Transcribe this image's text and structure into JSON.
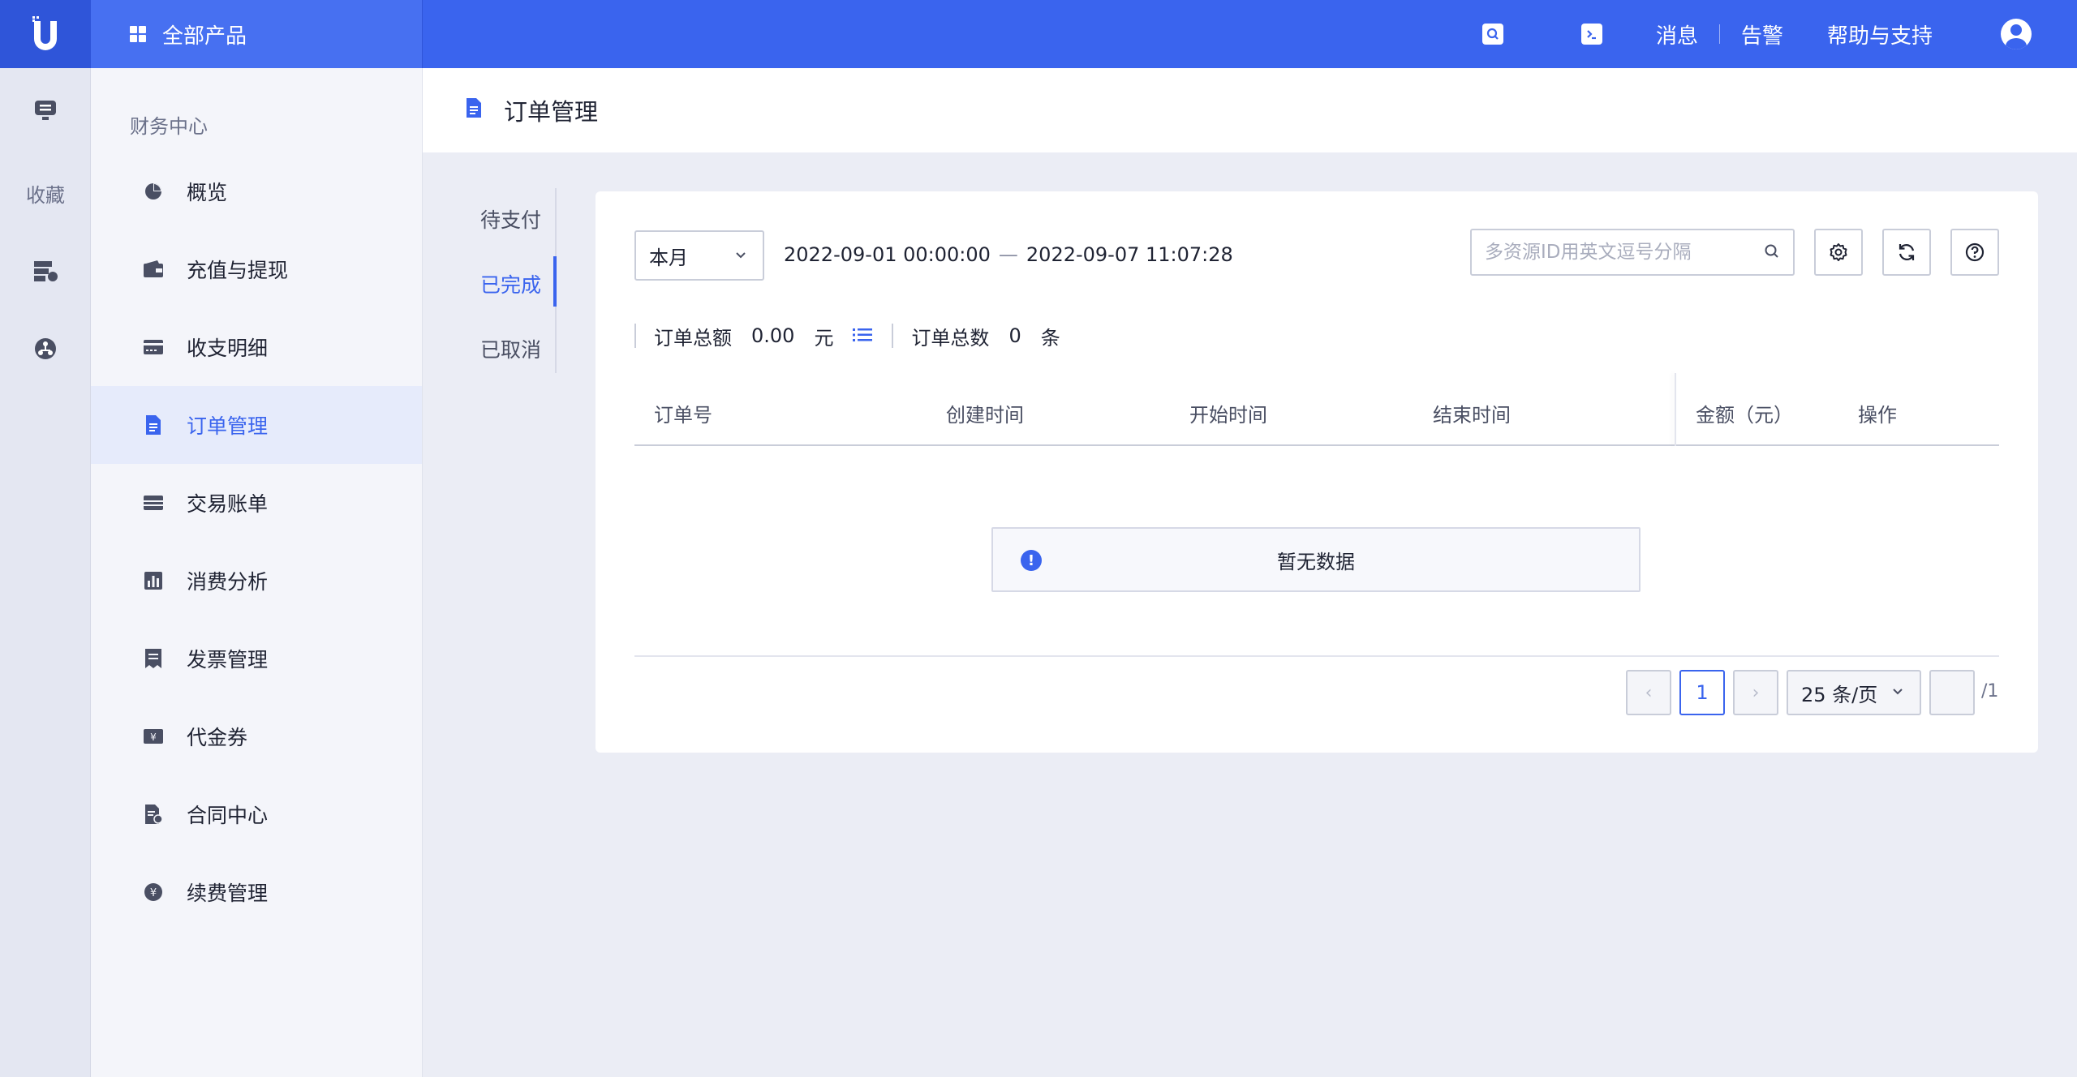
{
  "topbar": {
    "all_products": "全部产品",
    "links": [
      "消息",
      "告警",
      "帮助与支持"
    ]
  },
  "rail": {
    "favorites": "收藏"
  },
  "sidebar": {
    "title": "财务中心",
    "items": [
      {
        "label": "概览",
        "icon": "pie-chart-icon"
      },
      {
        "label": "充值与提现",
        "icon": "wallet-icon"
      },
      {
        "label": "收支明细",
        "icon": "card-icon"
      },
      {
        "label": "订单管理",
        "icon": "document-icon",
        "active": true
      },
      {
        "label": "交易账单",
        "icon": "ledger-icon"
      },
      {
        "label": "消费分析",
        "icon": "bar-chart-icon"
      },
      {
        "label": "发票管理",
        "icon": "invoice-icon"
      },
      {
        "label": "代金券",
        "icon": "voucher-icon"
      },
      {
        "label": "合同中心",
        "icon": "contract-icon"
      },
      {
        "label": "续费管理",
        "icon": "renewal-icon"
      }
    ]
  },
  "page": {
    "title": "订单管理"
  },
  "tabs": [
    "待支付",
    "已完成",
    "已取消"
  ],
  "active_tab": "已完成",
  "filter": {
    "period": "本月",
    "start": "2022-09-01 00:00:00",
    "dash": "—",
    "end": "2022-09-07 11:07:28",
    "search_placeholder": "多资源ID用英文逗号分隔"
  },
  "summary": {
    "amount_label": "订单总额",
    "amount_value": "0.00",
    "amount_unit": "元",
    "count_label": "订单总数",
    "count_value": "0",
    "count_unit": "条"
  },
  "table": {
    "columns": [
      "订单号",
      "创建时间",
      "开始时间",
      "结束时间",
      "金额（元）",
      "操作"
    ],
    "empty_text": "暂无数据"
  },
  "pagination": {
    "prev": "‹",
    "current": "1",
    "next": "›",
    "page_size": "25 条/页",
    "total": "/1"
  },
  "colors": {
    "primary": "#3a64ee",
    "background": "#ebedf5"
  }
}
